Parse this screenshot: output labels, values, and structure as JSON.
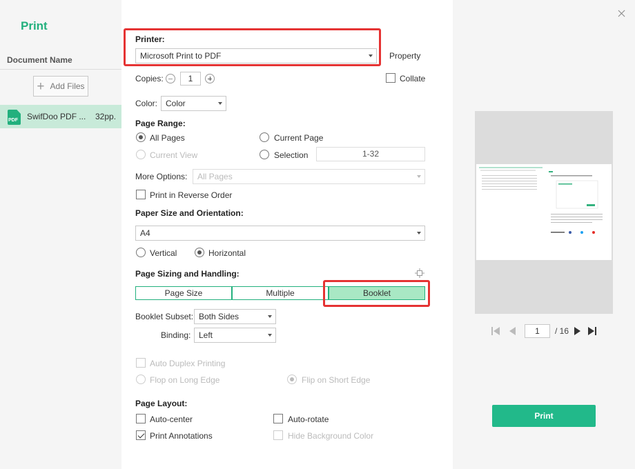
{
  "sidebar": {
    "title": "Print",
    "document_name_header": "Document Name",
    "add_files_label": "Add Files",
    "files": [
      {
        "name": "SwifDoo PDF ...",
        "pages": "32pp.",
        "icon_text": "PDF"
      }
    ]
  },
  "printer": {
    "label": "Printer:",
    "selected": "Microsoft Print to PDF",
    "property_label": "Property"
  },
  "copies": {
    "label": "Copies:",
    "value": "1",
    "collate_label": "Collate",
    "collate_checked": false
  },
  "color": {
    "label": "Color:",
    "selected": "Color"
  },
  "page_range": {
    "label": "Page Range:",
    "all_pages": "All Pages",
    "current_page": "Current Page",
    "current_view": "Current View",
    "selection": "Selection",
    "selection_value": "1-32",
    "selected_option": "All Pages"
  },
  "more_options": {
    "label": "More Options:",
    "selected": "All Pages"
  },
  "reverse_order": {
    "label": "Print in Reverse Order",
    "checked": false
  },
  "paper": {
    "label": "Paper Size and Orientation:",
    "size": "A4",
    "vertical": "Vertical",
    "horizontal": "Horizontal",
    "orientation": "Horizontal"
  },
  "sizing": {
    "label": "Page Sizing and Handling:",
    "tabs": [
      "Page Size",
      "Multiple",
      "Booklet"
    ],
    "active_tab": "Booklet"
  },
  "booklet": {
    "subset_label": "Booklet Subset:",
    "subset_value": "Both Sides",
    "binding_label": "Binding:",
    "binding_value": "Left"
  },
  "duplex": {
    "label": "Auto Duplex Printing",
    "flop_long": "Flop on Long Edge",
    "flip_short": "Flip on Short Edge"
  },
  "layout": {
    "label": "Page Layout:",
    "auto_center": "Auto-center",
    "auto_rotate": "Auto-rotate",
    "print_annotations": "Print Annotations",
    "hide_background": "Hide Background Color"
  },
  "preview": {
    "current_page": "1",
    "total_pages": "/ 16"
  },
  "print_button": "Print",
  "colors": {
    "accent": "#22b07d",
    "highlight": "#e53333",
    "active_tab": "#a9e8c4"
  }
}
